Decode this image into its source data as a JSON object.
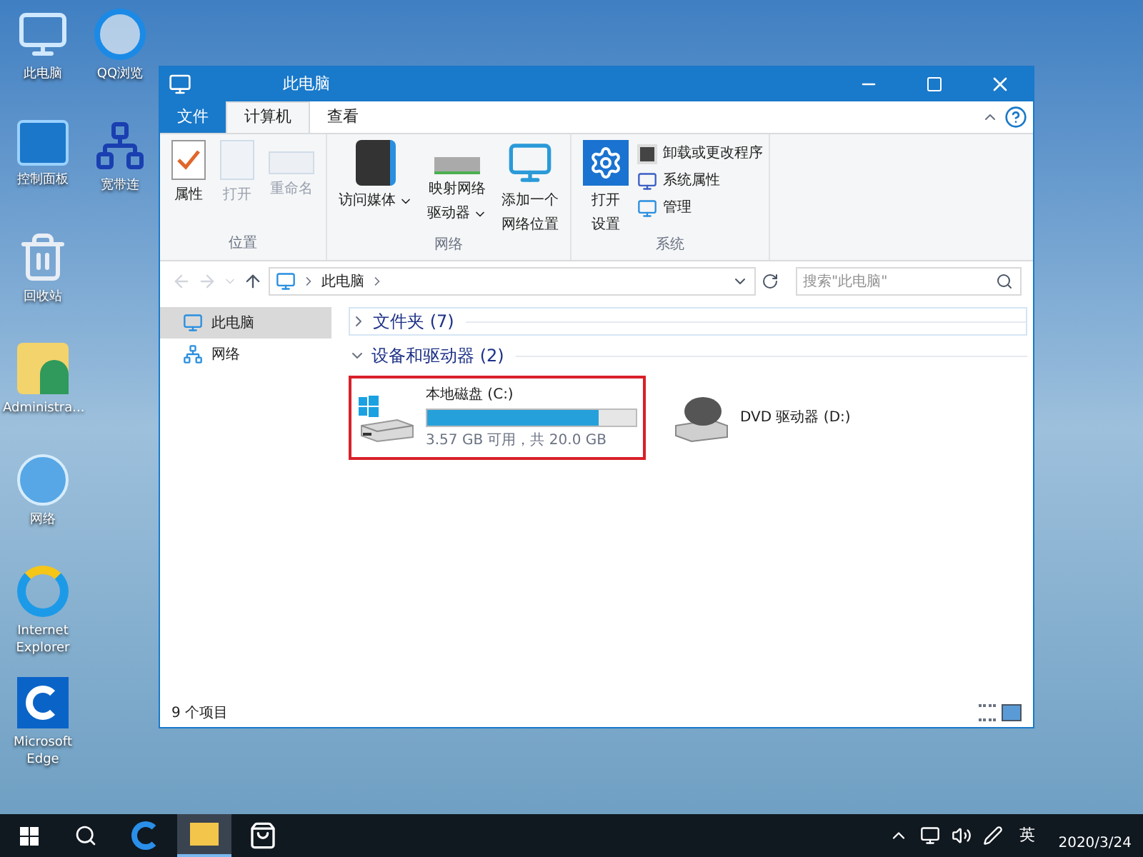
{
  "desktop_icons": [
    {
      "label": "此电脑",
      "kind": "computer"
    },
    {
      "label": "QQ浏览",
      "kind": "browser"
    },
    {
      "label": "控制面板",
      "kind": "control"
    },
    {
      "label": "宽带连",
      "kind": "network-pc"
    },
    {
      "label": "回收站",
      "kind": "recycle"
    },
    {
      "label": "Administra...",
      "kind": "user"
    },
    {
      "label": "网络",
      "kind": "network"
    },
    {
      "label": "Internet Explorer",
      "kind": "ie"
    },
    {
      "label": "Microsoft Edge",
      "kind": "edge"
    }
  ],
  "window": {
    "title": "此电脑"
  },
  "ribbon_tabs": [
    {
      "label": "文件",
      "selected": false,
      "kind": "file"
    },
    {
      "label": "计算机",
      "selected": true,
      "kind": "tab"
    },
    {
      "label": "查看",
      "selected": false,
      "kind": "tab"
    }
  ],
  "ribbon_groups": [
    {
      "label": "位置",
      "items": [
        {
          "lines": [
            "属性"
          ],
          "disabled": false,
          "kind": "properties"
        },
        {
          "lines": [
            "打开"
          ],
          "disabled": true,
          "kind": "open"
        },
        {
          "lines": [
            "重命名"
          ],
          "disabled": true,
          "kind": "rename"
        }
      ]
    },
    {
      "label": "网络",
      "items": [
        {
          "lines": [
            "访问媒体"
          ],
          "disabled": false,
          "kind": "media",
          "dropdown": true
        },
        {
          "lines": [
            "映射网络",
            "驱动器"
          ],
          "disabled": false,
          "kind": "drive",
          "dropdown": true
        },
        {
          "lines": [
            "添加一个",
            "网络位置"
          ],
          "disabled": false,
          "kind": "netloc",
          "dropdown": false
        }
      ]
    },
    {
      "label": "系统",
      "items": [
        {
          "lines": [
            "打开",
            "设置"
          ],
          "disabled": false,
          "kind": "settings"
        }
      ],
      "small_items": [
        {
          "label": "卸载或更改程序",
          "kind": "uninstall"
        },
        {
          "label": "系统属性",
          "kind": "sysprop"
        },
        {
          "label": "管理",
          "kind": "manage"
        }
      ]
    }
  ],
  "address": {
    "path": [
      "此电脑"
    ],
    "search_placeholder": "搜索\"此电脑\""
  },
  "nav_pane": [
    {
      "label": "此电脑",
      "selected": true,
      "kind": "computer"
    },
    {
      "label": "网络",
      "selected": false,
      "kind": "network"
    }
  ],
  "sections": [
    {
      "title": "文件夹 (7)",
      "expanded": false
    },
    {
      "title": "设备和驱动器 (2)",
      "expanded": true,
      "items": [
        {
          "kind": "disk",
          "name": "本地磁盘 (C:)",
          "level": 0.82,
          "detail": "3.57 GB 可用，共 20.0 GB",
          "highlighted": true
        },
        {
          "kind": "dvd",
          "name": "DVD 驱动器 (D:)",
          "highlighted": false
        }
      ]
    }
  ],
  "status_bar": {
    "count": "9 个项目"
  },
  "taskbar": {
    "input_indicator": "英",
    "date": "2020/3/24"
  }
}
